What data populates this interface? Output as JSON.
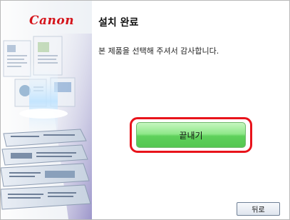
{
  "brand": {
    "logo_text": "Canon",
    "logo_color": "#d5141b"
  },
  "dialog": {
    "title": "설치 완료",
    "message": "본 제품을 선택해 주셔서 감사합니다."
  },
  "buttons": {
    "finish_label": "끝내기",
    "back_label": "뒤로"
  },
  "colors": {
    "highlight_ring": "#e8131b",
    "finish_button": "#5ed05b"
  }
}
